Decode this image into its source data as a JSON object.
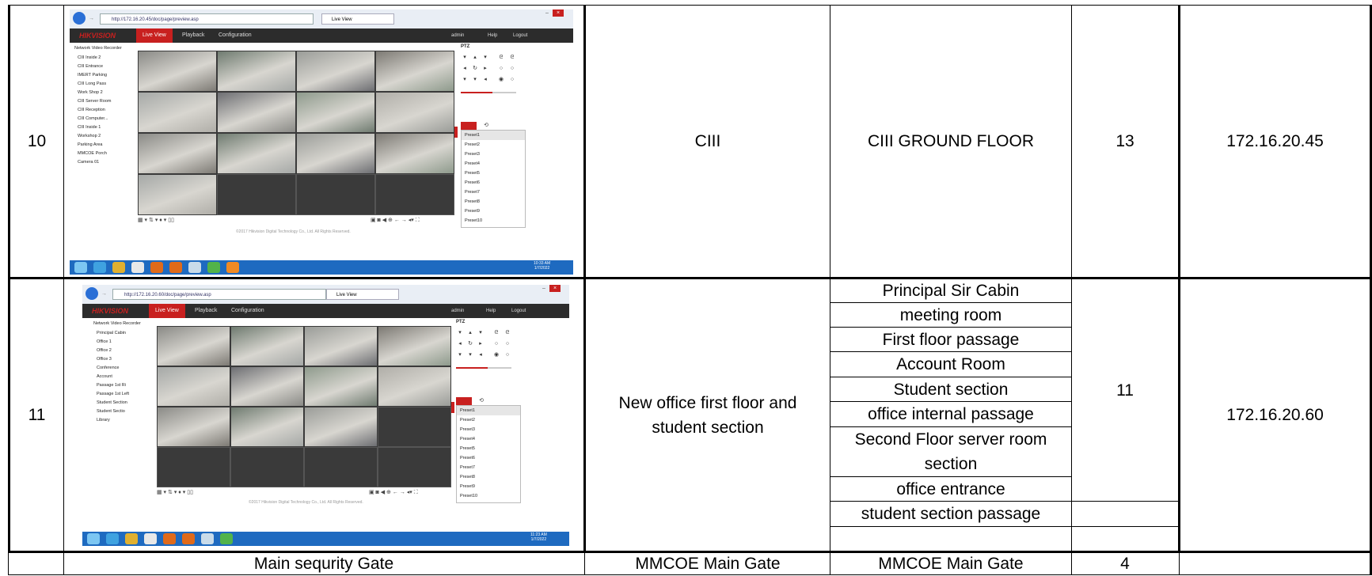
{
  "rows": [
    {
      "no": "10",
      "location": "CIII",
      "areas": [
        "CIII GROUND FLOOR"
      ],
      "count": "13",
      "ip": "172.16.20.45",
      "screenshot": {
        "url": "http://172.16.20.45/doc/page/preview.asp",
        "tab": "Live View",
        "brand": "HIKVISION",
        "nav": [
          "Live View",
          "Playback",
          "Configuration"
        ],
        "user": "admin",
        "help": "Help",
        "logout": "Logout",
        "tree_root": "Network Video Recorder",
        "cameras": [
          "CIII Inside 2",
          "CIII Entrance",
          "IMERT Parking",
          "CIII Long Pass",
          "Work Shop 2",
          "CIII Server Room",
          "CIII Reception",
          "CIII Computer...",
          "CIII Inside 1",
          "Workshop 2",
          "Parking Area",
          "MMCOE Porch",
          "Camera 01"
        ],
        "ptz_title": "PTZ",
        "presets": [
          "Preset1",
          "Preset2",
          "Preset3",
          "Preset4",
          "Preset5",
          "Preset6",
          "Preset7",
          "Preset8",
          "Preset9",
          "Preset10"
        ],
        "footer": "©2017 Hikvision Digital Technology Co., Ltd. All Rights Reserved.",
        "clock_time": "10:33 AM",
        "clock_date": "1/7/2022"
      }
    },
    {
      "no": "11",
      "location": "New office first floor and student section",
      "areas": [
        "Principal Sir Cabin",
        "meeting room",
        "First floor passage",
        "Account Room",
        "Student section",
        "office internal passage",
        "Second Floor server room section",
        "office entrance",
        "student section passage",
        ""
      ],
      "count": "11",
      "ip": "172.16.20.60",
      "screenshot": {
        "url": "http://172.16.20.60/doc/page/preview.asp",
        "tab": "Live View",
        "brand": "HIKVISION",
        "nav": [
          "Live View",
          "Playback",
          "Configuration"
        ],
        "user": "admin",
        "help": "Help",
        "logout": "Logout",
        "tree_root": "Network Video Recorder",
        "cameras": [
          "Principal Cabin",
          "Office 1",
          "Office 2",
          "Office 3",
          "Conference",
          "Account",
          "Passage 1st Ri",
          "Passage 1st Left",
          "Student Section",
          "Student Sectio",
          "Library"
        ],
        "ptz_title": "PTZ",
        "presets": [
          "Preset1",
          "Preset2",
          "Preset3",
          "Preset4",
          "Preset5",
          "Preset6",
          "Preset7",
          "Preset8",
          "Preset9",
          "Preset10"
        ],
        "footer": "©2017 Hikvision Digital Technology Co., Ltd. All Rights Reserved.",
        "clock_time": "11:23 AM",
        "clock_date": "1/7/2022"
      }
    },
    {
      "no": "",
      "description": "Main sequrity Gate",
      "location": "MMCOE Main Gate",
      "areas": [
        "MMCOE Main Gate"
      ],
      "count": "4",
      "ip": ""
    }
  ],
  "colors": {
    "hik_red": "#c8201f",
    "nav_dark": "#2c2c2c",
    "taskbar_blue": "#1e6ac0",
    "grid_gray": "#3a3a3a"
  }
}
